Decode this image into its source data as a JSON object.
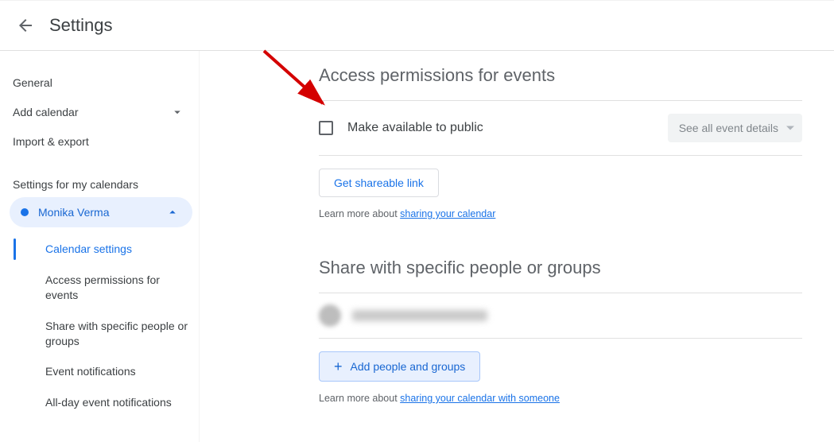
{
  "header": {
    "title": "Settings"
  },
  "sidebar": {
    "general": "General",
    "add_calendar": "Add calendar",
    "import_export": "Import & export",
    "section_heading": "Settings for my calendars",
    "calendar_name": "Monika Verma",
    "sub": {
      "calendar_settings": "Calendar settings",
      "access_permissions": "Access permissions for events",
      "share_specific": "Share with specific people or groups",
      "event_notifications": "Event notifications",
      "allday_notifications": "All-day event notifications"
    }
  },
  "access": {
    "title": "Access permissions for events",
    "make_public": "Make available to public",
    "visibility_option": "See all event details",
    "shareable_btn": "Get shareable link",
    "helper_prefix": "Learn more about ",
    "helper_link": "sharing your calendar"
  },
  "share": {
    "title": "Share with specific people or groups",
    "add_btn": "Add people and groups",
    "helper_prefix": "Learn more about ",
    "helper_link": "sharing your calendar with someone"
  }
}
